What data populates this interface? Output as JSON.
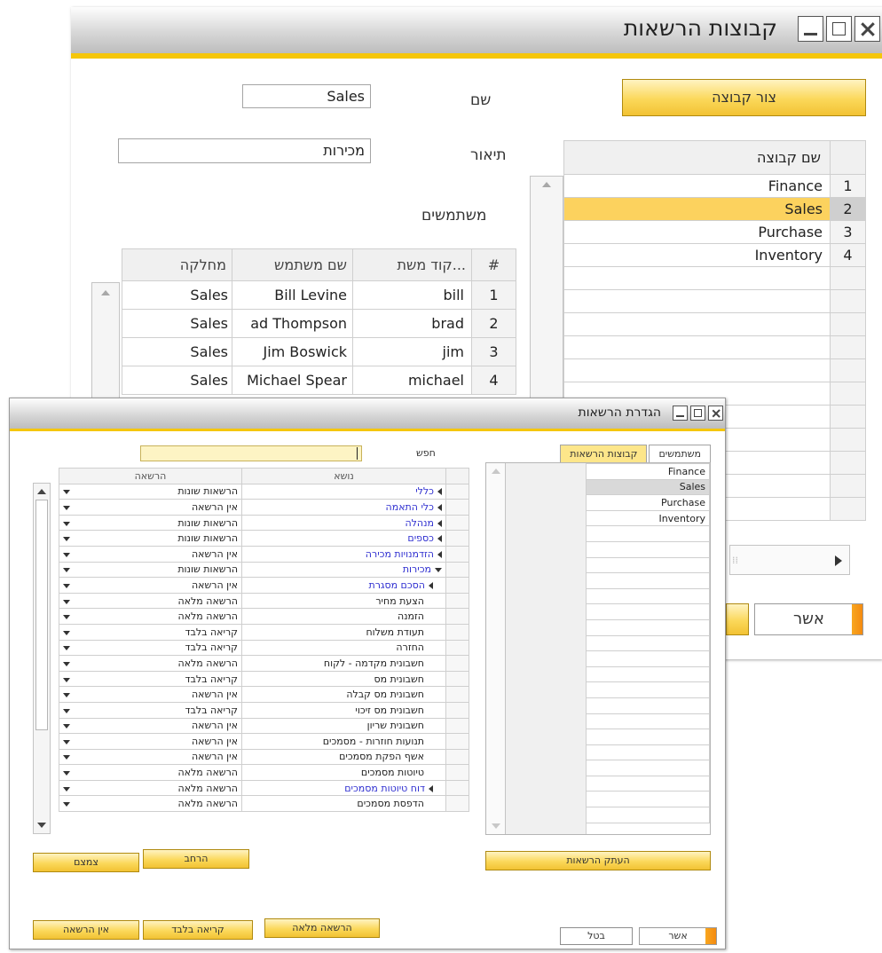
{
  "win1": {
    "title": "קבוצות הרשאות",
    "create_group_button": "צור קבוצה",
    "name_label": "שם",
    "name_value": "Sales",
    "description_label": "תיאור",
    "description_value": "מכירות",
    "users_label": "משתמשים",
    "ok_button": "אשר",
    "groups_grid": {
      "header": "שם קבוצה",
      "rows": [
        {
          "num": "1",
          "name": "Finance"
        },
        {
          "num": "2",
          "name": "Sales"
        },
        {
          "num": "3",
          "name": "Purchase"
        },
        {
          "num": "4",
          "name": "Inventory"
        }
      ]
    },
    "users_grid": {
      "headers": {
        "num": "#",
        "code": "קוד משת...",
        "user": "שם משתמש",
        "dept": "מחלקה"
      },
      "rows": [
        {
          "num": "1",
          "code": "bill",
          "user": "Bill Levine",
          "dept": "Sales"
        },
        {
          "num": "2",
          "code": "brad",
          "user": "ad Thompson",
          "dept": "Sales"
        },
        {
          "num": "3",
          "code": "jim",
          "user": "Jim Boswick",
          "dept": "Sales"
        },
        {
          "num": "4",
          "code": "michael",
          "user": "Michael Spear",
          "dept": "Sales"
        }
      ]
    }
  },
  "win2": {
    "title": "הגדרת הרשאות",
    "search_label": "חפש",
    "search_value": "",
    "tabs": [
      "משתמשים",
      "קבוצות הרשאות"
    ],
    "groups_list": [
      "Finance",
      "Sales",
      "Purchase",
      "Inventory"
    ],
    "perm_headers": {
      "subject": "נושא",
      "permission": "הרשאה"
    },
    "perm_rows": [
      {
        "subject": "כללי",
        "permission": "הרשאות שונות"
      },
      {
        "subject": "כלי התאמה",
        "permission": "אין הרשאה"
      },
      {
        "subject": "מנהלה",
        "permission": "הרשאות שונות"
      },
      {
        "subject": "כספים",
        "permission": "הרשאות שונות"
      },
      {
        "subject": "הזדמנויות מכירה",
        "permission": "אין הרשאה"
      },
      {
        "subject": "מכירות",
        "permission": "הרשאות שונות"
      },
      {
        "subject": "הסכם מסגרת",
        "permission": "אין הרשאה"
      },
      {
        "subject": "הצעת מחיר",
        "permission": "הרשאה מלאה"
      },
      {
        "subject": "הזמנה",
        "permission": "הרשאה מלאה"
      },
      {
        "subject": "תעודת משלוח",
        "permission": "קריאה בלבד"
      },
      {
        "subject": "החזרה",
        "permission": "קריאה בלבד"
      },
      {
        "subject": "חשבונית מקדמה - לקוח",
        "permission": "הרשאה מלאה"
      },
      {
        "subject": "חשבונית מס",
        "permission": "קריאה בלבד"
      },
      {
        "subject": "חשבונית מס קבלה",
        "permission": "אין הרשאה"
      },
      {
        "subject": "חשבונית מס זיכוי",
        "permission": "קריאה בלבד"
      },
      {
        "subject": "חשבונית שריון",
        "permission": "אין הרשאה"
      },
      {
        "subject": "תנועות חוזרות - מסמכים",
        "permission": "אין הרשאה"
      },
      {
        "subject": "אשף הפקת מסמכים",
        "permission": "אין הרשאה"
      },
      {
        "subject": "טיוטות מסמכים",
        "permission": "הרשאה מלאה"
      },
      {
        "subject": "דוח טיוטות מסמכים",
        "permission": "הרשאה מלאה"
      },
      {
        "subject": "הדפסת מסמכים",
        "permission": "הרשאה מלאה"
      }
    ],
    "copy_button": "העתק הרשאות",
    "collapse_button": "צמצם",
    "expand_button": "הרחב",
    "no_perm_button": "אין הרשאה",
    "read_only_button": "קריאה בלבד",
    "full_perm_button": "הרשאה מלאה",
    "ok_button": "אשר",
    "cancel_button": "בטל"
  }
}
